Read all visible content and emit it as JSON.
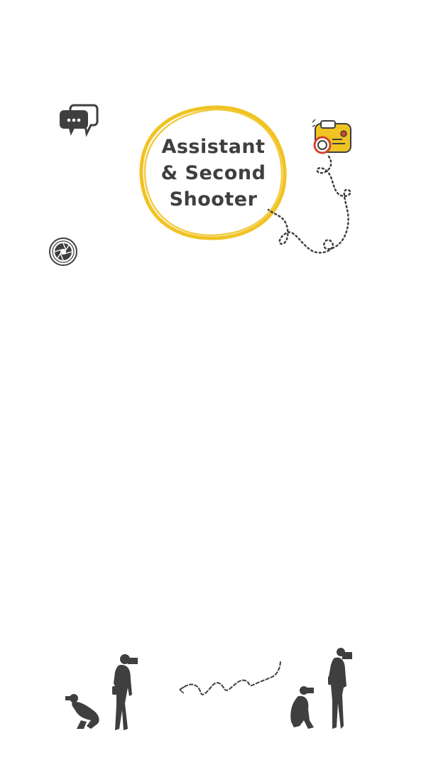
{
  "title": {
    "line1": "Assistant",
    "line2": "& Second",
    "line3": "Shooter"
  },
  "colors": {
    "accent": "#f0c323",
    "ink": "#3f3f40",
    "background": "#ffffff"
  },
  "icons": [
    "chat-bubbles-icon",
    "camera-icon",
    "shutter-aperture-icon"
  ]
}
